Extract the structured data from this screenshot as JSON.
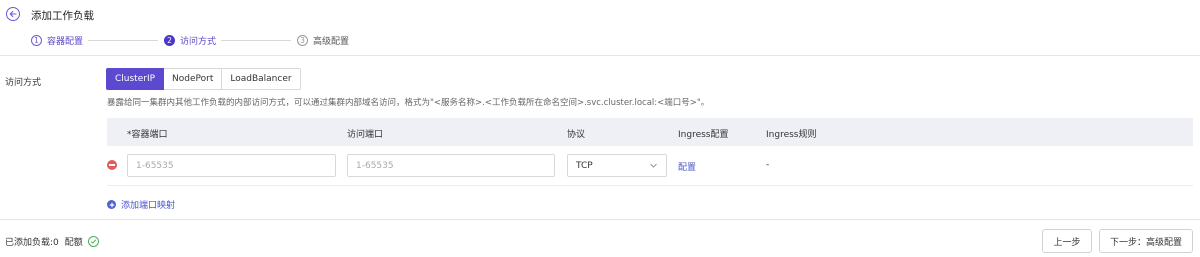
{
  "header": {
    "title": "添加工作负载"
  },
  "steps": [
    {
      "num": "1",
      "label": "容器配置"
    },
    {
      "num": "2",
      "label": "访问方式"
    },
    {
      "num": "3",
      "label": "高级配置"
    }
  ],
  "access": {
    "label": "访问方式",
    "options": [
      "ClusterIP",
      "NodePort",
      "LoadBalancer"
    ],
    "selected": "ClusterIP",
    "description": "暴露给同一集群内其他工作负载的内部访问方式，可以通过集群内部域名访问，格式为\"<服务名称>.<工作负载所在命名空间>.svc.cluster.local:<端口号>\"。"
  },
  "table": {
    "headers": {
      "container_port": "*容器端口",
      "access_port": "访问端口",
      "protocol": "协议",
      "ingress_config": "Ingress配置",
      "ingress_rules": "Ingress规则"
    },
    "rows": [
      {
        "container_port_placeholder": "1-65535",
        "access_port_placeholder": "1-65535",
        "protocol": "TCP",
        "ingress_config": "配置",
        "ingress_rules": "-"
      }
    ],
    "add_label": "添加端口映射"
  },
  "footer": {
    "added": "已添加负载:0",
    "quota": "配额",
    "prev": "上一步",
    "next": "下一步：高级配置"
  },
  "colors": {
    "accent": "#5b49cf",
    "link": "#4a55c8",
    "danger": "#e35b5b",
    "success": "#4caf50",
    "table_header_bg": "#eef0f6"
  },
  "icons": {
    "back": "arrow-left-icon",
    "remove": "minus-circle-icon",
    "add": "plus-circle-icon",
    "select": "chevron-down-icon",
    "quota": "check-circle-icon"
  }
}
